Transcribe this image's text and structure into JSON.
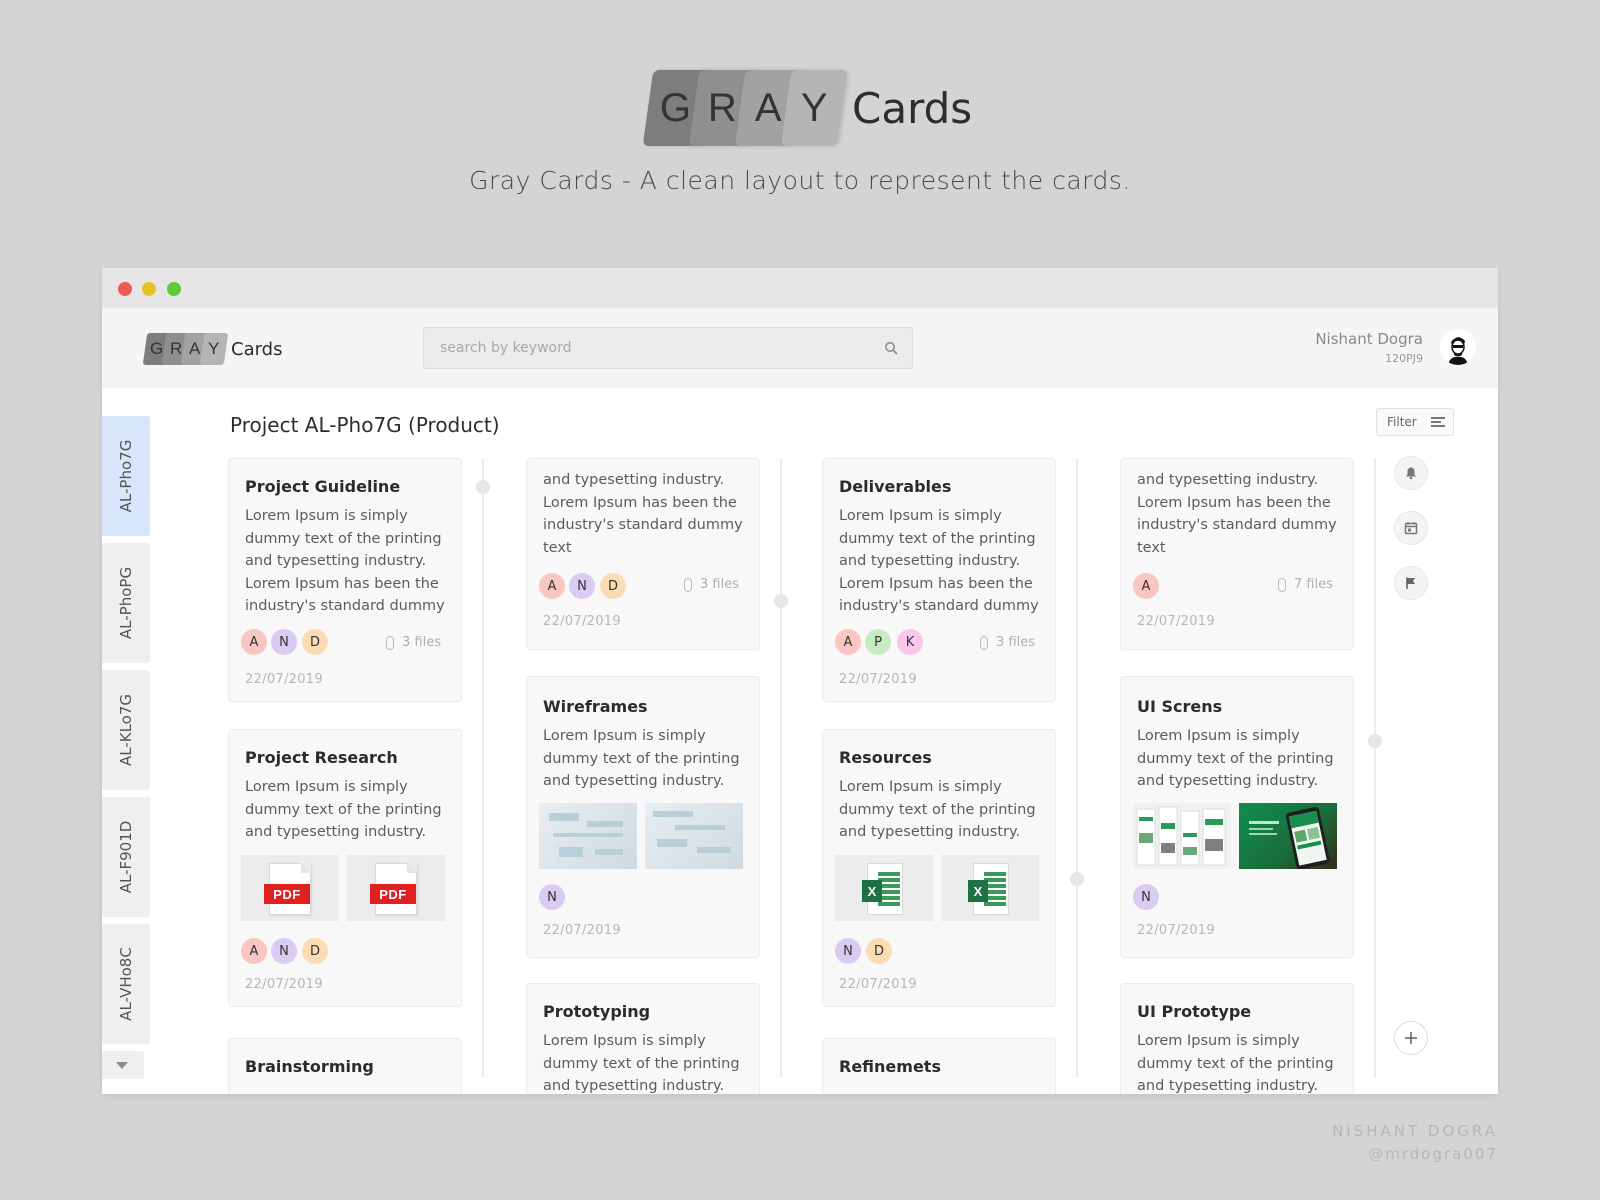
{
  "hero": {
    "logo_letters": [
      "G",
      "R",
      "A",
      "Y"
    ],
    "logo_word": "Cards",
    "subtitle": "Gray Cards - A clean layout to represent the cards."
  },
  "app": {
    "logo_letters": [
      "G",
      "R",
      "A",
      "Y"
    ],
    "logo_word": "Cards",
    "search": {
      "placeholder": "search by keyword",
      "value": ""
    },
    "user": {
      "name": "Nishant Dogra",
      "id": "120PJ9"
    }
  },
  "sidebar": {
    "tabs": [
      {
        "label": "AL-Pho7G",
        "active": true
      },
      {
        "label": "AL-PhoPG",
        "active": false
      },
      {
        "label": "AL-KLo7G",
        "active": false
      },
      {
        "label": "AL-F901D",
        "active": false
      },
      {
        "label": "AL-VHo8C",
        "active": false
      }
    ]
  },
  "project": {
    "title": "Project AL-Pho7G (Product)",
    "filter_label": "Filter"
  },
  "columns": [
    {
      "cards": [
        {
          "title": "Project Guideline",
          "body": "Lorem Ipsum is simply dummy text of the printing and typesetting industry. Lorem Ipsum has been the industry's standard dummy",
          "avatars": [
            "A",
            "N",
            "D"
          ],
          "files": "3 files",
          "date": "22/07/2019"
        },
        {
          "title": "Project Research",
          "body": "Lorem Ipsum is simply dummy text of the printing and typesetting industry.",
          "attachments": [
            "PDF",
            "PDF"
          ],
          "avatars": [
            "A",
            "N",
            "D"
          ],
          "date": "22/07/2019"
        },
        {
          "title": "Brainstorming"
        }
      ]
    },
    {
      "cards": [
        {
          "body": "and typesetting industry. Lorem Ipsum has been the industry's standard dummy text",
          "avatars": [
            "A",
            "N",
            "D"
          ],
          "files": "3 files",
          "date": "22/07/2019"
        },
        {
          "title": "Wireframes",
          "body": "Lorem Ipsum is simply dummy text of the printing and typesetting industry.",
          "avatars": [
            "N"
          ],
          "date": "22/07/2019"
        },
        {
          "title": "Prototyping",
          "body": "Lorem Ipsum is simply dummy text of the printing and typesetting industry."
        }
      ]
    },
    {
      "cards": [
        {
          "title": "Deliverables",
          "body": "Lorem Ipsum is simply dummy text of the printing and typesetting industry. Lorem Ipsum has been the industry's standard dummy",
          "avatars": [
            "A",
            "P",
            "K"
          ],
          "files": "3 files",
          "date": "22/07/2019"
        },
        {
          "title": "Resources",
          "body": "Lorem Ipsum is simply dummy text of the printing and typesetting industry.",
          "attachments": [
            "X",
            "X"
          ],
          "avatars": [
            "N",
            "D"
          ],
          "date": "22/07/2019"
        },
        {
          "title": "Refinemets"
        }
      ]
    },
    {
      "cards": [
        {
          "body": "and typesetting industry. Lorem Ipsum has been the industry's standard dummy text",
          "avatars": [
            "A"
          ],
          "files": "7 files",
          "date": "22/07/2019"
        },
        {
          "title": "UI Screns",
          "body": "Lorem Ipsum is simply dummy text of the printing and typesetting industry.",
          "avatars": [
            "N"
          ],
          "date": "22/07/2019"
        },
        {
          "title": "UI Prototype",
          "body": "Lorem Ipsum is simply dummy text of the printing and typesetting industry."
        }
      ]
    }
  ],
  "rail": {
    "icons": [
      "bell-icon",
      "calendar-icon",
      "flag-icon",
      "plus-icon"
    ]
  },
  "colors": {
    "avatar_A": "#f9c6c2",
    "avatar_N": "#d9ccf3",
    "avatar_D": "#fbdcb4",
    "avatar_P": "#c6ebc3",
    "avatar_K": "#f8c8ec",
    "active_tab": "#d8e6fb"
  },
  "credit": {
    "name": "NISHANT DOGRA",
    "handle": "@mrdogra007"
  }
}
